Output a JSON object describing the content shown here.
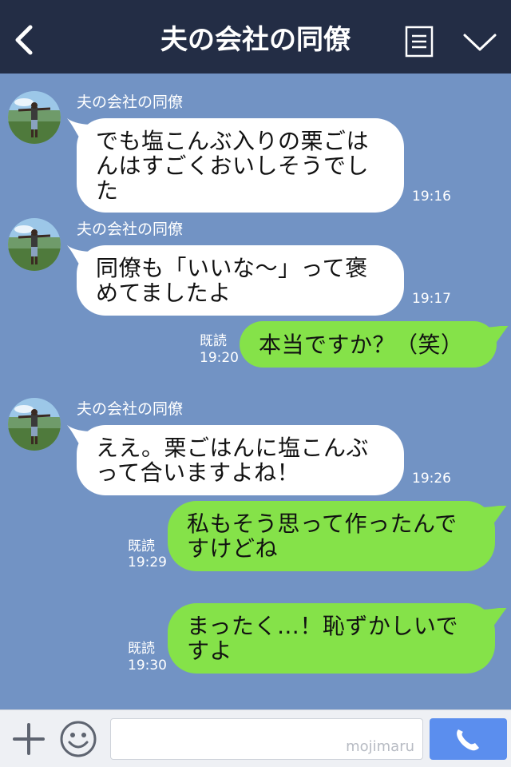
{
  "header": {
    "title": "夫の会社の同僚"
  },
  "messages": [
    {
      "side": "in",
      "sender": "夫の会社の同僚",
      "text": "でも塩こんぶ入りの栗ごはんはすごくおいしそうでした",
      "time": "19:16"
    },
    {
      "side": "in",
      "sender": "夫の会社の同僚",
      "text": "同僚も「いいな〜」って褒めてましたよ",
      "time": "19:17"
    },
    {
      "side": "out",
      "read": "既読",
      "text": "本当ですか？（笑）",
      "time": "19:20"
    },
    {
      "side": "in",
      "sender": "夫の会社の同僚",
      "text": "ええ。栗ごはんに塩こんぶって合いますよね！",
      "time": "19:26"
    },
    {
      "side": "out",
      "read": "既読",
      "text": "私もそう思って作ったんですけどね",
      "time": "19:29"
    },
    {
      "side": "out",
      "read": "既読",
      "text": "まったく…！恥ずかしいですよ",
      "time": "19:30"
    }
  ],
  "footer": {
    "input_placeholder": "",
    "watermark": "mojimaru"
  },
  "colors": {
    "header": "#232d45",
    "background": "#7293c4",
    "incoming_bubble": "#ffffff",
    "outgoing_bubble": "#85e249",
    "call_button": "#5b8eee"
  },
  "icons": {
    "back": "chevron-left-icon",
    "menu": "notes-icon",
    "collapse": "chevron-down-icon",
    "add": "plus-icon",
    "emoji": "smiley-icon",
    "call": "phone-icon"
  }
}
